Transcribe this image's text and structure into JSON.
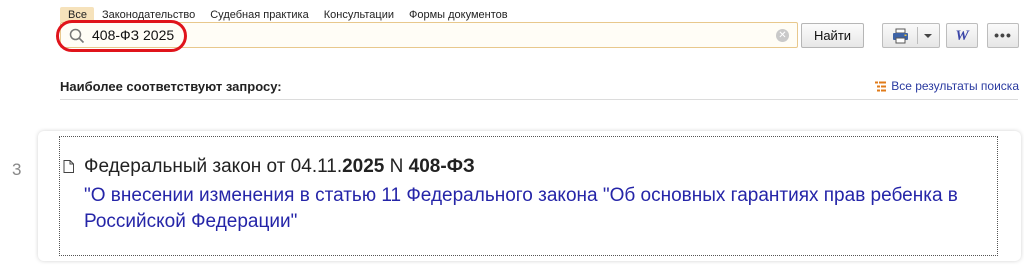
{
  "tabs": [
    {
      "label": "Все",
      "active": true
    },
    {
      "label": "Законодательство",
      "active": false
    },
    {
      "label": "Судебная практика",
      "active": false
    },
    {
      "label": "Консультации",
      "active": false
    },
    {
      "label": "Формы документов",
      "active": false
    }
  ],
  "search": {
    "value": "408-ФЗ 2025",
    "button_label": "Найти",
    "highlight_color": "#e0141b"
  },
  "toolbar": {
    "print_icon": "printer-icon",
    "word_label": "W",
    "more_label": "•••"
  },
  "results": {
    "heading": "Наиболее соответствуют запросу:",
    "all_results_label": "Все результаты поиска",
    "items": [
      {
        "number": "3",
        "title_prefix": "Федеральный закон от 04.11.",
        "title_year": "2025",
        "title_middle": " N ",
        "title_law": "408-ФЗ",
        "subtitle": "\"О внесении изменения в статью 11 Федерального закона \"Об основных гарантиях прав ребенка в Российской Федерации\""
      }
    ]
  },
  "colors": {
    "tab_active_bg": "#f6e2bb",
    "link": "#2525a8",
    "search_border": "#e8c88c"
  }
}
